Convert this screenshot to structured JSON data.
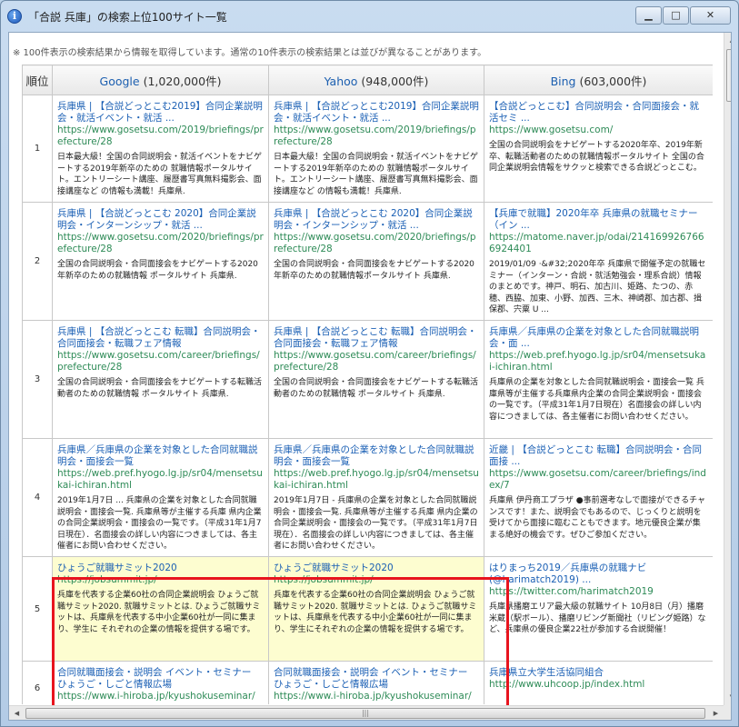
{
  "window": {
    "title": "「合説 兵庫」の検索上位100サイト一覧",
    "buttons": {
      "minimize": "▁",
      "maximize": "□",
      "close": "✕"
    }
  },
  "notice": "※ 100件表示の検索結果から情報を取得しています。通常の10件表示の検索結果とは並びが異なることがあります。",
  "table": {
    "headers": {
      "rank": "順位",
      "google_name": "Google",
      "google_count": " (1,020,000件)",
      "yahoo_name": "Yahoo",
      "yahoo_count": " (948,000件)",
      "bing_name": "Bing",
      "bing_count": " (603,000件)"
    },
    "rows": [
      {
        "rank": "1",
        "google": {
          "title": "兵庫県 | 【合説どっとこむ2019】合同企業説明会・就活イベント・就活 ...",
          "url": "https://www.gosetsu.com/2019/briefings/prefecture/28",
          "desc": "日本最大級！全国の合同説明会・就活イベントをナビゲートする2019年新卒のための 就職情報ポータルサイト。エントリーシート講座、履歴書写真無料撮影会、面接講座など の情報も満載！兵庫県."
        },
        "yahoo": {
          "title": "兵庫県 | 【合説どっとこむ2019】合同企業説明会・就活イベント・就活 ...",
          "url": "https://www.gosetsu.com/2019/briefings/prefecture/28",
          "desc": "日本最大級！全国の合同説明会・就活イベントをナビゲートする2019年新卒のための 就職情報ポータルサイト。エントリーシート講座、履歴書写真無料撮影会、面接講座など の情報も満載！兵庫県."
        },
        "bing": {
          "title": "【合説どっとこむ】合同説明会・合同面接会・就活セミ ...",
          "url": "https://www.gosetsu.com/",
          "desc": "全国の合同説明会をナビゲートする2020年卒、2019年新卒、転職活動者のための就職情報ポータルサイト 全国の合同企業説明会情報をサクッと検索できる合説どっとこむ。"
        }
      },
      {
        "rank": "2",
        "google": {
          "title": "兵庫県 | 【合説どっとこむ 2020】合同企業説明会・インターンシップ・就活 ...",
          "url": "https://www.gosetsu.com/2020/briefings/prefecture/28",
          "desc": "全国の合同説明会・合同面接会をナビゲートする2020年新卒のための就職情報 ポータルサイト 兵庫県."
        },
        "yahoo": {
          "title": "兵庫県 | 【合説どっとこむ 2020】合同企業説明会・インターンシップ・就活 ...",
          "url": "https://www.gosetsu.com/2020/briefings/prefecture/28",
          "desc": "全国の合同説明会・合同面接会をナビゲートする2020年新卒のための就職情報ポータルサイト 兵庫県."
        },
        "bing": {
          "title": "【兵庫で就職】2020年卒 兵庫県の就職セミナー（イン ...",
          "url": "https://matome.naver.jp/odai/2141699267666924401",
          "desc": "2019/01/09 ·&#32;2020年卒 兵庫県で開催予定の就職セミナー（インターン・合説・就活勉強会・理系合説）情報のまとめです。神戸、明石、加古川、姫路、たつの、赤穂、西脇、加東、小野、加西、三木、神崎郡、加古郡、揖保郡、宍粟 U ..."
        }
      },
      {
        "rank": "3",
        "google": {
          "title": "兵庫県 | 【合説どっとこむ 転職】合同説明会・合同面接会・転職フェア情報",
          "url": "https://www.gosetsu.com/career/briefings/prefecture/28",
          "desc": "全国の合同説明会・合同面接会をナビゲートする転職活動者のための就職情報 ポータルサイト 兵庫県."
        },
        "yahoo": {
          "title": "兵庫県 | 【合説どっとこむ 転職】合同説明会・合同面接会・転職フェア情報",
          "url": "https://www.gosetsu.com/career/briefings/prefecture/28",
          "desc": "全国の合同説明会・合同面接会をナビゲートする転職活動者のための就職情報 ポータルサイト 兵庫県."
        },
        "bing": {
          "title": "兵庫県／兵庫県の企業を対象とした合同就職説明会・面 ...",
          "url": "https://web.pref.hyogo.lg.jp/sr04/mensetsukai-ichiran.html",
          "desc": "兵庫県の企業を対象とした合同就職説明会・面接会一覧 兵庫県等が主催する兵庫県内企業の合同企業説明会・面接会の一覧です。（平成31年1月7日現在）名面接会の詳しい内容につきましては、各主催者にお問い合わせください。"
        }
      },
      {
        "rank": "4",
        "google": {
          "title": "兵庫県／兵庫県の企業を対象とした合同就職説明会・面接会一覧",
          "url": "https://web.pref.hyogo.lg.jp/sr04/mensetsukai-ichiran.html",
          "desc": "2019年1月7日 ... 兵庫県の企業を対象とした合同就職説明会・面接会一覧. 兵庫県等が主催する兵庫 県内企業の合同企業説明会・面接会の一覧です。（平成31年1月7日現在）．名面接会の詳しい内容につきましては、各主催者にお問い合わせください。"
        },
        "yahoo": {
          "title": "兵庫県／兵庫県の企業を対象とした合同就職説明会・面接会一覧",
          "url": "https://web.pref.hyogo.lg.jp/sr04/mensetsukai-ichiran.html",
          "desc": "2019年1月7日 - 兵庫県の企業を対象とした合同就職説明会・面接会一覧. 兵庫県等が主催する兵庫 県内企業の合同企業説明会・面接会の一覧です。（平成31年1月7日現在）．名面接会の詳しい内容につきましては、各主催者にお問い合わせください。"
        },
        "bing": {
          "title": "近畿 | 【合説どっとこむ 転職】合同説明会・合同面接 ...",
          "url": "https://www.gosetsu.com/career/briefings/index/7",
          "desc": "兵庫県 伊丹商工プラザ ●事前選考なしで面接ができるチャンスです！また、説明会でもあるので、じっくりと説明を受けてから面接に臨むこともできます。地元優良企業が集まる絶好の機会です。ぜひご参加ください。"
        }
      },
      {
        "rank": "5",
        "google": {
          "title": "ひょうご就職サミット2020",
          "url": "https://jobsummit.jp/",
          "desc": "兵庫を代表する企業60社の合同企業説明会 ひょうご就職サミット2020. 就職サミットとは. ひょうご就職サミットは、兵庫県を代表する中小企業60社が一同に集まり、学生に それぞれの企業の情報を提供する場です。"
        },
        "yahoo": {
          "title": "ひょうご就職サミット2020",
          "url": "https://jobsummit.jp/",
          "desc": "兵庫を代表する企業60社の合同企業説明会 ひょうご就職サミット2020. 就職サミットとは. ひょうご就職サミットは、兵庫県を代表する中小企業60社が一同に集まり、学生にそれぞれの企業の情報を提供する場です。"
        },
        "bing": {
          "title": "はりまっち2019／兵庫県の就職ナビ (@harimatch2019) ...",
          "url": "https://twitter.com/harimatch2019",
          "desc": "兵庫県播磨エリア最大級の就職サイト 10月8日（月）播磨米蔵（駅ボール）、播磨リビング新聞社（リビング姫路）など、兵庫県の優良企業22社が参加する合説開催！"
        }
      },
      {
        "rank": "6",
        "google": {
          "title": "合同就職面接会・説明会 イベント・セミナー ひょうご・しごと情報広場",
          "url": "https://www.i-hiroba.jp/kyushokuseminar/",
          "desc": ""
        },
        "yahoo": {
          "title": "合同就職面接会・説明会 イベント・セミナー ひょうご・しごと情報広場",
          "url": "https://www.i-hiroba.jp/kyushokuseminar/",
          "desc": ""
        },
        "bing": {
          "title": "兵庫県立大学生活協同組合",
          "url": "http://www.uhcoop.jp/index.html",
          "desc": ""
        }
      }
    ]
  },
  "highlight_color": "#fdfdd0",
  "highlight_border_color": "#e8141e"
}
